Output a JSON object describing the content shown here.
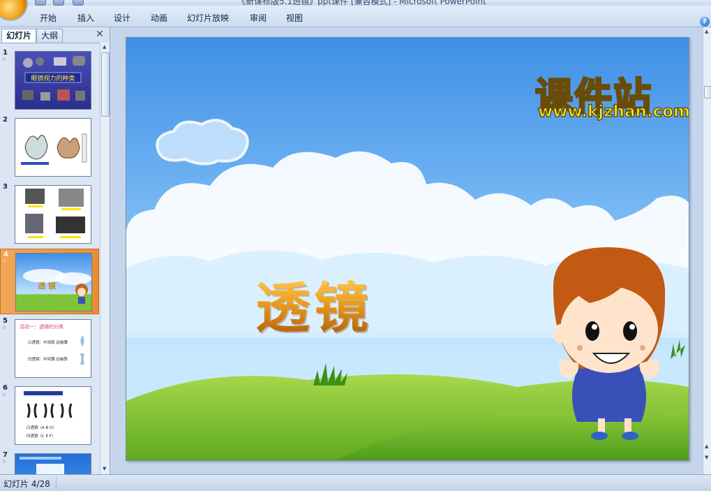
{
  "window": {
    "title": "《新课标版5.1透镜》ppt课件 [兼容模式] - Microsoft PowerPoint"
  },
  "ribbon": {
    "tabs": [
      {
        "label": "开始"
      },
      {
        "label": "插入"
      },
      {
        "label": "设计"
      },
      {
        "label": "动画"
      },
      {
        "label": "幻灯片放映"
      },
      {
        "label": "审阅"
      },
      {
        "label": "视图"
      }
    ],
    "help_label": "?"
  },
  "pane": {
    "tab_slides": "幻灯片",
    "tab_outline": "大纲",
    "close_label": "✕",
    "slides": [
      {
        "num": "1",
        "title": "眼镜视力的种类"
      },
      {
        "num": "2"
      },
      {
        "num": "3"
      },
      {
        "num": "4",
        "title": "透 镜",
        "selected": true
      },
      {
        "num": "5",
        "title": "活动一：透镜的分类",
        "lines": [
          "凸透镜：中间厚 边缘薄",
          "凹透镜：中间薄 边缘厚"
        ]
      },
      {
        "num": "6",
        "lines": [
          "凸透镜（A B D）",
          "凹透镜（C E F）"
        ]
      },
      {
        "num": "7"
      }
    ]
  },
  "slide": {
    "title": "透镜",
    "logo_cn": "课件站",
    "logo_url": "www.kjzhan.com"
  },
  "status": {
    "text": "幻灯片 4/28"
  },
  "colors": {
    "selection": "#e88d34",
    "sky_top": "#3f8fe6",
    "grass": "#7fc436",
    "title_gold": "#f4a11c"
  }
}
